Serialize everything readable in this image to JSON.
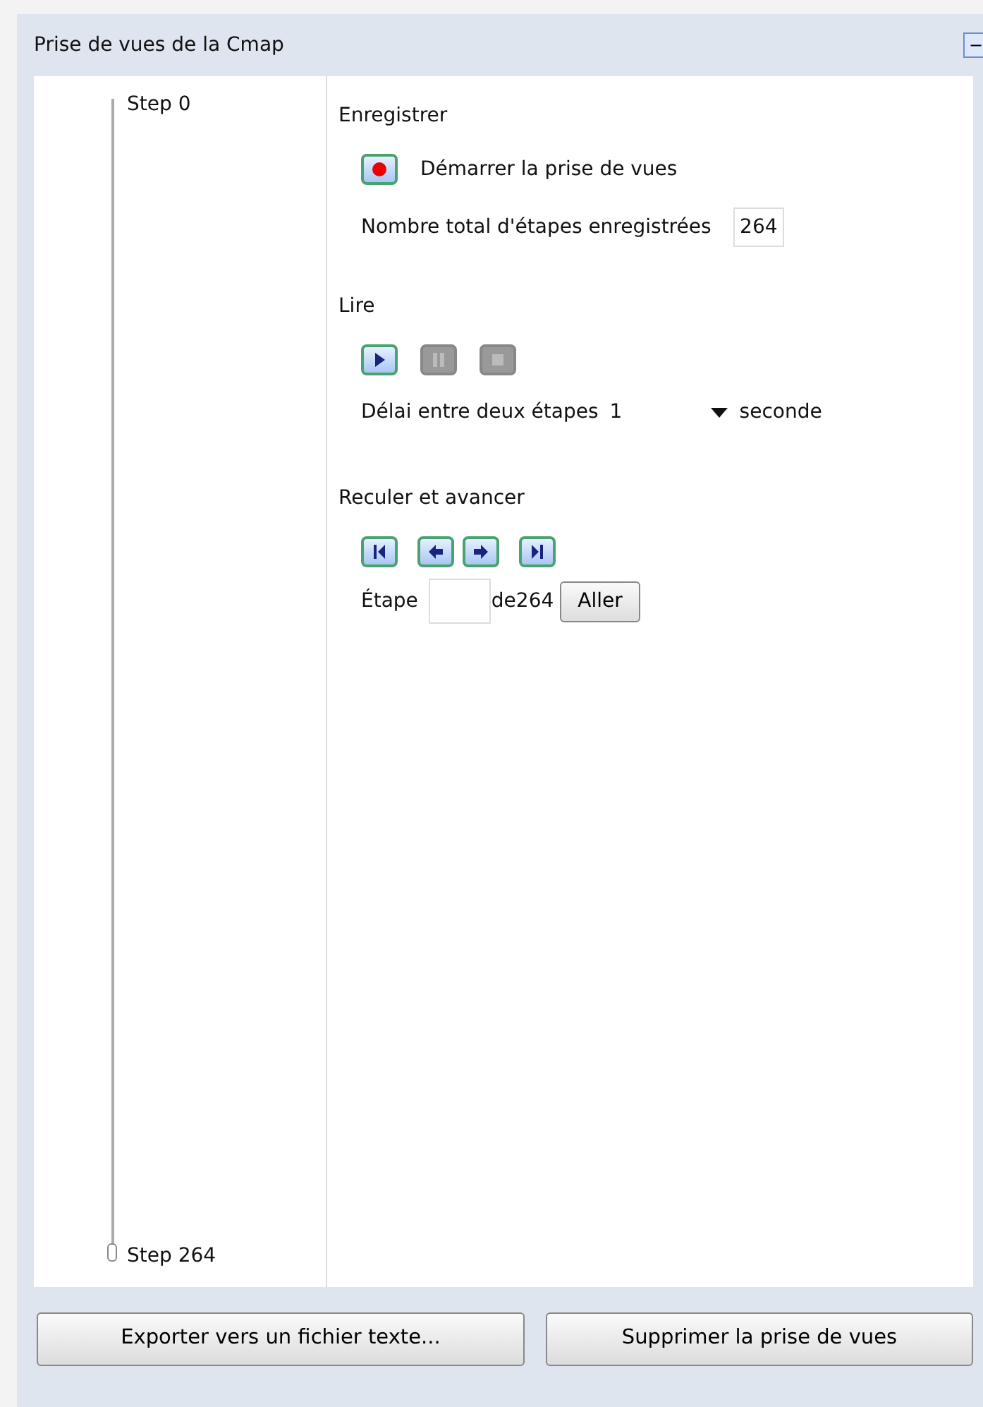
{
  "panel": {
    "title": "Prise de vues de la Cmap",
    "minimize_label": "−"
  },
  "timeline": {
    "start_label": "Step 0",
    "end_label": "Step 264",
    "level": 1
  },
  "record": {
    "heading": "Enregistrer",
    "button": {
      "kind": "record",
      "disabled": false
    },
    "button_label": "Démarrer la prise de vues",
    "total_label": "Nombre total d'étapes enregistrées",
    "total_value": "264"
  },
  "play": {
    "heading": "Lire",
    "buttons": [
      {
        "kind": "play",
        "disabled": false
      },
      {
        "kind": "pause",
        "disabled": true
      },
      {
        "kind": "stop",
        "disabled": true
      }
    ],
    "delay_label": "Délai entre deux étapes",
    "delay_value": "1",
    "delay_unit": "seconde"
  },
  "navigate": {
    "heading": "Reculer et avancer",
    "buttons": [
      {
        "kind": "first",
        "disabled": false
      },
      {
        "kind": "back",
        "disabled": false
      },
      {
        "kind": "forward",
        "disabled": false
      },
      {
        "kind": "last",
        "disabled": false
      }
    ],
    "step_label": "Étape",
    "step_of": "de264",
    "go_button": "Aller"
  },
  "footer_buttons": [
    "Exporter vers un fichier texte...",
    "Supprimer la prise de vues"
  ]
}
